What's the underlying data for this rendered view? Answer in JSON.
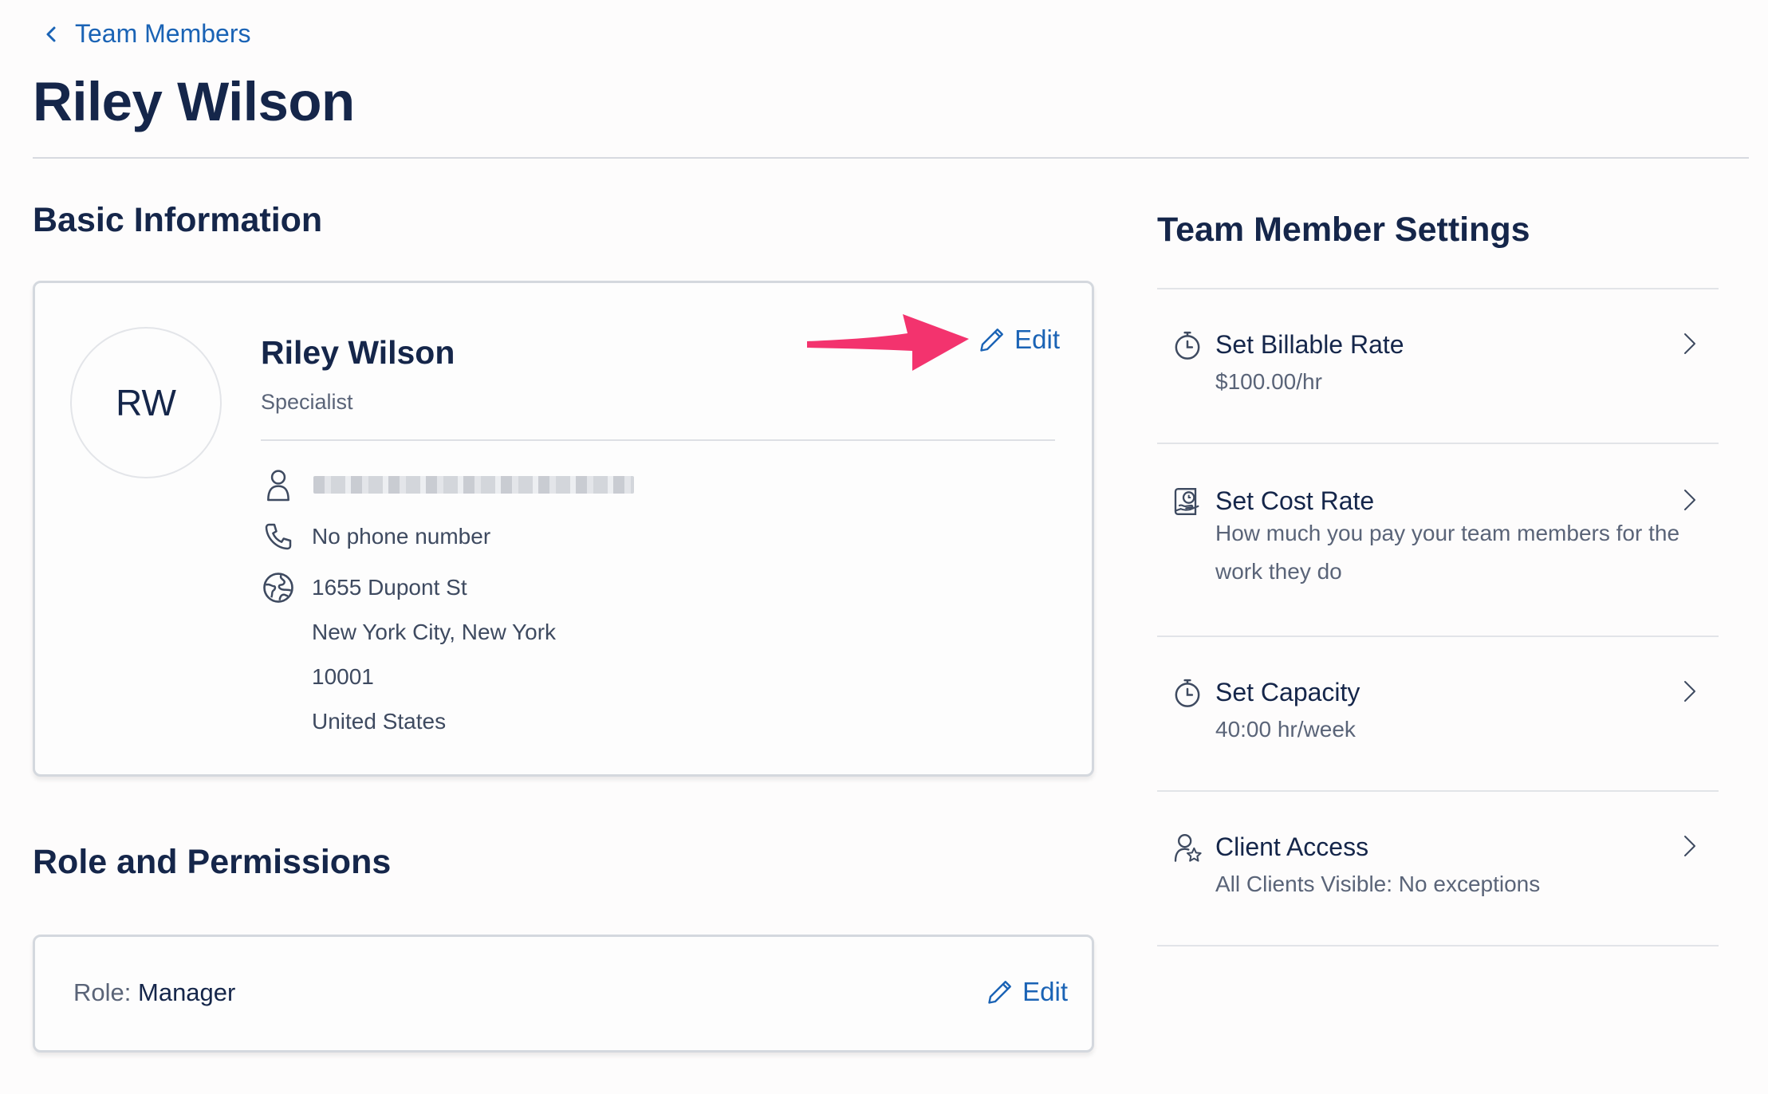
{
  "breadcrumb": {
    "label": "Team Members"
  },
  "page": {
    "title": "Riley Wilson"
  },
  "basic_info": {
    "section_title": "Basic Information",
    "initials": "RW",
    "name": "Riley Wilson",
    "job_title": "Specialist",
    "edit_label": "Edit",
    "phone": "No phone number",
    "address": {
      "street": "1655 Dupont St",
      "city_state": "New York City, New York",
      "zip": "10001",
      "country": "United States"
    }
  },
  "role_permissions": {
    "section_title": "Role and Permissions",
    "role_key": "Role:",
    "role_value": "Manager",
    "edit_label": "Edit"
  },
  "settings": {
    "section_title": "Team Member Settings",
    "items": [
      {
        "title": "Set Billable Rate",
        "description": "$100.00/hr",
        "icon": "stopwatch-icon"
      },
      {
        "title": "Set Cost Rate",
        "description": "How much you pay your team members for the work they do",
        "icon": "cost-rate-icon"
      },
      {
        "title": "Set Capacity",
        "description": "40:00 hr/week",
        "icon": "stopwatch-icon"
      },
      {
        "title": "Client Access",
        "description": "All Clients Visible: No exceptions",
        "icon": "client-star-icon"
      }
    ]
  },
  "colors": {
    "accent": "#1a63b5",
    "heading": "#15264a",
    "annotation_arrow": "#f3336e"
  }
}
